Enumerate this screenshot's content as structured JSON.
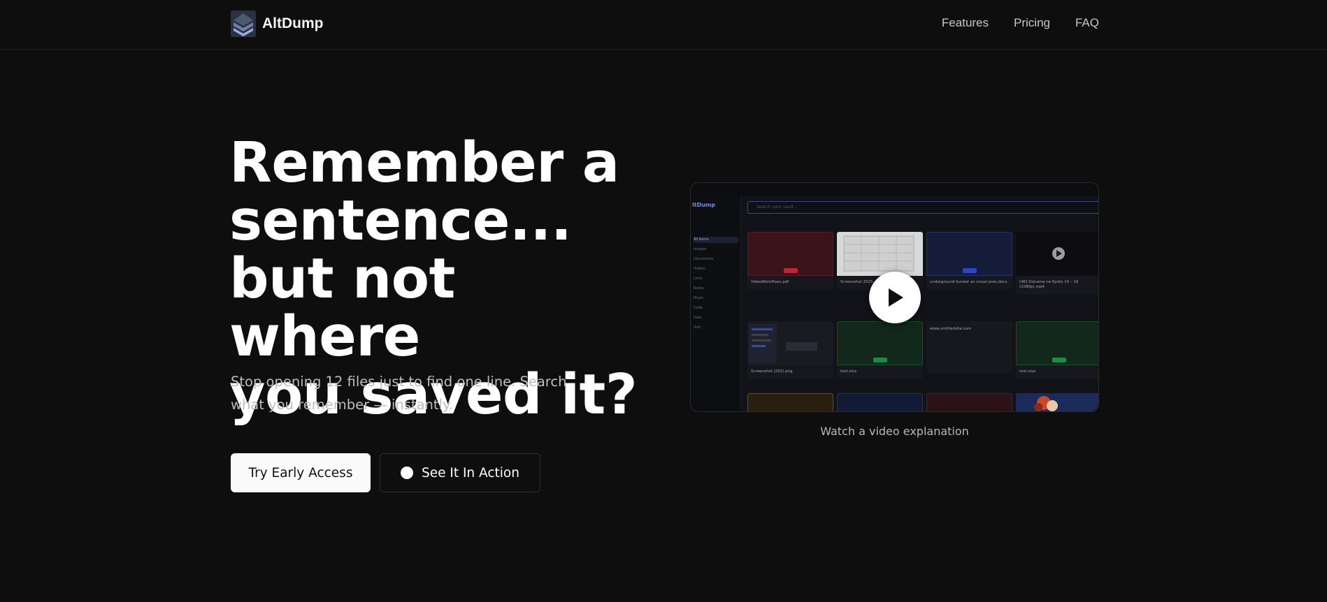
{
  "nav": {
    "brand": "AltDump",
    "links": [
      "Features",
      "Pricing",
      "FAQ"
    ]
  },
  "hero": {
    "headline_lines": [
      "Remember a",
      "sentence...",
      "but not where",
      "you saved it?"
    ],
    "subtext": "Stop opening 12 files just to find one line. Search what you remember — instantly.",
    "primary_cta": "Try Early Access",
    "secondary_cta": "See It In Action"
  },
  "video": {
    "caption": "Watch a video explanation",
    "app": {
      "logo": "ltDump",
      "search_placeholder": "Search your vault...",
      "sidebar": [
        "All Items",
        "Images",
        "Documents",
        "Videos",
        "Links",
        "Notes",
        "Music",
        "Code",
        "Data",
        "Sort"
      ],
      "row1_cards": [
        "VideoWorkflows.pdf",
        "Screenshot 2025-...",
        "underground bunker as visual pres.docx",
        "[4K] Diorama no Kyoto 14 – 16 (1080p).mp4"
      ],
      "row2_cards": [
        "Screenshot (202).png",
        "test.xlsx",
        "www.untitledsite.com",
        "test.xlsx"
      ]
    }
  },
  "colors": {
    "background": "#0e0e0f",
    "primary_button": "#fafafa",
    "accent_blue": "#3b4a86"
  }
}
